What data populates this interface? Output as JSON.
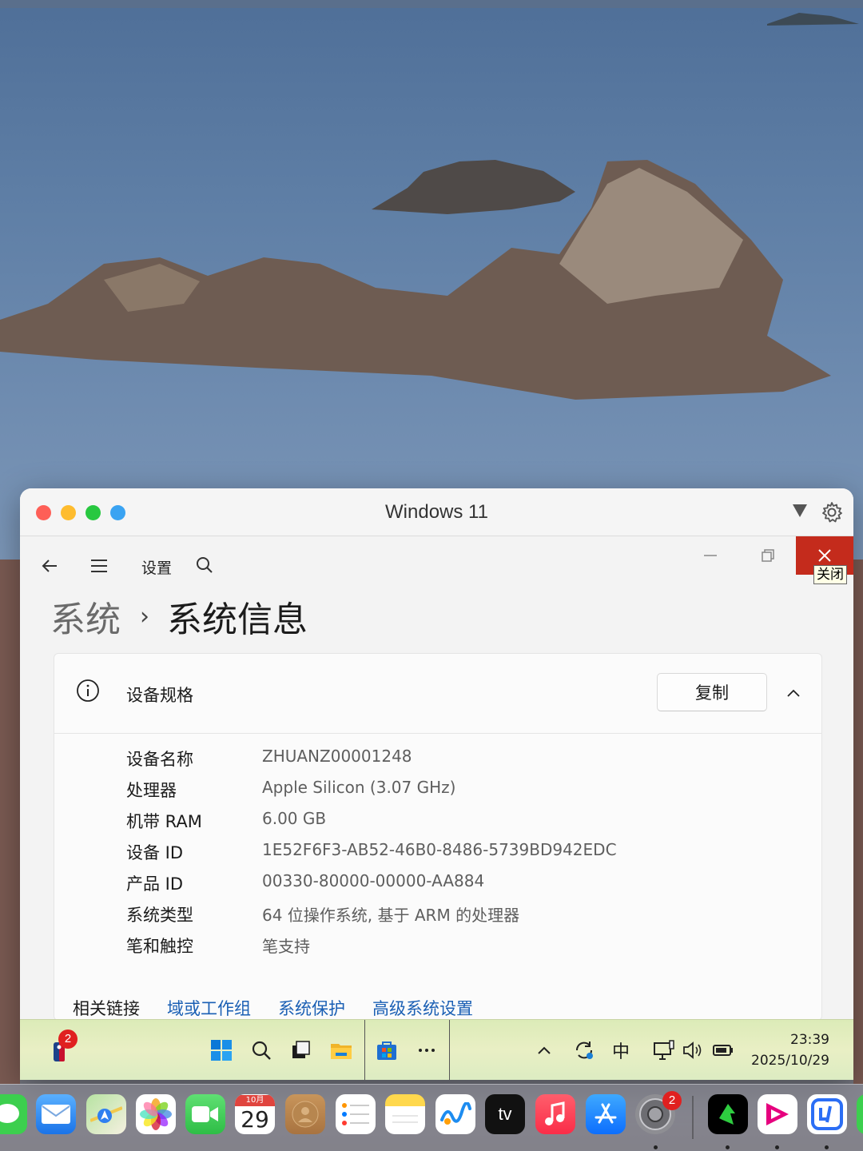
{
  "vm": {
    "title": "Windows 11"
  },
  "settings": {
    "nav_title": "设置",
    "close_tooltip": "关闭",
    "breadcrumb": {
      "parent": "系统",
      "current": "系统信息"
    },
    "card": {
      "title": "设备规格",
      "copy_label": "复制",
      "specs": [
        {
          "label": "设备名称",
          "value": "ZHUANZ00001248"
        },
        {
          "label": "处理器",
          "value": "Apple Silicon (3.07 GHz)"
        },
        {
          "label": "机带 RAM",
          "value": "6.00 GB"
        },
        {
          "label": "设备 ID",
          "value": "1E52F6F3-AB52-46B0-8486-5739BD942EDC"
        },
        {
          "label": "产品 ID",
          "value": "00330-80000-00000-AA884"
        },
        {
          "label": "系统类型",
          "value": "64 位操作系统, 基于 ARM 的处理器"
        },
        {
          "label": "笔和触控",
          "value": "笔支持"
        }
      ]
    },
    "related": {
      "title": "相关链接",
      "links": [
        "域或工作组",
        "系统保护",
        "高级系统设置"
      ]
    }
  },
  "taskbar": {
    "nba_badge": "2",
    "ime": "中",
    "time": "23:39",
    "date": "2025/10/29"
  },
  "dock": {
    "calendar_month": "10月",
    "calendar_day": "29",
    "tv_label": "tv",
    "settings_badge": "2",
    "icons": [
      "messages-icon",
      "mail-icon",
      "maps-icon",
      "photos-icon",
      "facetime-icon",
      "calendar-icon",
      "contacts-icon",
      "reminders-icon",
      "notes-icon",
      "freeform-icon",
      "apple-tv-icon",
      "music-icon",
      "app-store-icon",
      "system-settings-icon",
      "app-1-icon",
      "app-2-icon",
      "app-3-icon"
    ]
  },
  "colors": {
    "close_red": "#c42b1c",
    "link_blue": "#1a5fb4",
    "traffic_red": "#fe5f57",
    "traffic_yellow": "#febc2e",
    "traffic_green": "#28c840",
    "traffic_blue": "#3aa3f2"
  }
}
